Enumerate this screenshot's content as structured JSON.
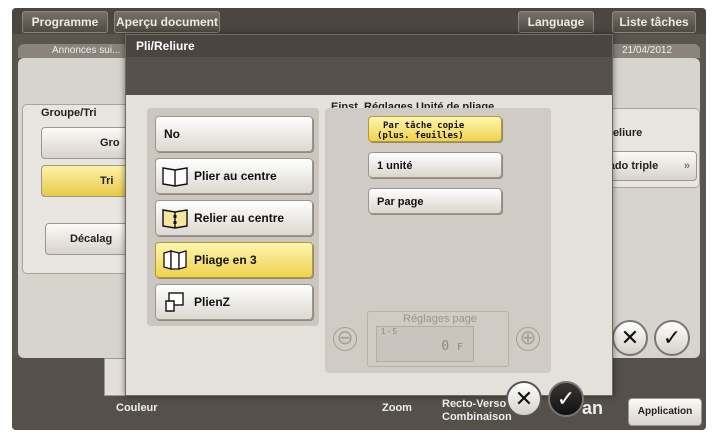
{
  "header": {
    "tabs": [
      "Programme",
      "Aperçu document",
      "Language",
      "Liste tâches"
    ],
    "subbar_left": "Annonces sui...",
    "date": "21/04/2012"
  },
  "background": {
    "groupe_tri_title": "Groupe/Tri",
    "btn_groupe": "Gro",
    "btn_tri": "Tri",
    "btn_decalage": "Décalag",
    "reliure_label": "Reliure",
    "pliage_triple": "gado triple",
    "bottom_labels": [
      "Couleur",
      "Zoom",
      "Recto-Verso Combinaison",
      "Application"
    ],
    "bottom_letters": "an"
  },
  "dialog": {
    "title": "Pli/Reliure",
    "options": [
      {
        "label": "No",
        "icon": "none",
        "selected": false
      },
      {
        "label": "Plier au centre",
        "icon": "book-fold-icon",
        "selected": false
      },
      {
        "label": "Relier au centre",
        "icon": "book-staple-icon",
        "selected": false
      },
      {
        "label": "Pliage en 3",
        "icon": "tri-fold-icon",
        "selected": true
      },
      {
        "label": "PlienZ",
        "icon": "z-fold-icon",
        "selected": false
      }
    ],
    "unit_settings_title": "Einst. Réglages Unité de pliage",
    "unit_options": [
      {
        "label_line1": "Par tâche copie",
        "label_line2": "(plus. feuilles)",
        "selected": true
      },
      {
        "label_line1": "1 unité",
        "label_line2": "",
        "selected": false
      },
      {
        "label_line1": "Par page",
        "label_line2": "",
        "selected": false
      }
    ],
    "page_settings": {
      "title": "Réglages page",
      "range_hint": "1 - 5",
      "value": "0",
      "unit": "F",
      "minus": "⊖",
      "plus": "⊕"
    },
    "cancel_symbol": "✕",
    "ok_symbol": "✓"
  },
  "colors": {
    "selected": "#efd24e",
    "title_bar": "#4a4541",
    "dialog_bg": "#e4e0da"
  }
}
